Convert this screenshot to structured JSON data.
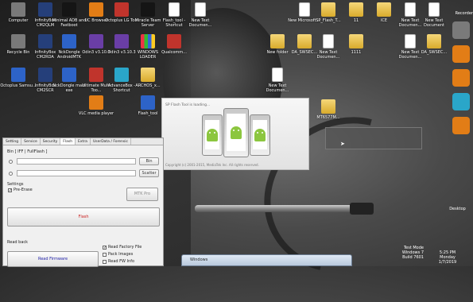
{
  "desktop": {
    "icons": [
      {
        "label": "Computer",
        "kind": "gray"
      },
      {
        "label": "InfinityBox CM2QLM",
        "kind": "navy"
      },
      {
        "label": "Minimal ADB and Fastboot",
        "kind": "black"
      },
      {
        "label": "UC Browser",
        "kind": "orange"
      },
      {
        "label": "Octoplus LG Tool",
        "kind": "red"
      },
      {
        "label": "Miracle Team Server",
        "kind": "black"
      },
      {
        "label": "Flash_tool - Shortcut",
        "kind": "doc"
      },
      {
        "label": "New Text Documen...",
        "kind": "doc"
      },
      {
        "label": "New Microsoft ...",
        "kind": "doc"
      },
      {
        "label": "SP_Flash_T...",
        "kind": "folder"
      },
      {
        "label": "11",
        "kind": "folder"
      },
      {
        "label": "ICE",
        "kind": "folder"
      },
      {
        "label": "New Text Documen...",
        "kind": "doc"
      },
      {
        "label": "New Text Document",
        "kind": "doc"
      },
      {
        "label": "Recycle Bin",
        "kind": "gray"
      },
      {
        "label": "InfinityBox CM2RDA",
        "kind": "navy"
      },
      {
        "label": "NckDongle AndroidMTK",
        "kind": "blue"
      },
      {
        "label": "Odin3 v3.10.3",
        "kind": "purple"
      },
      {
        "label": "Odin3 v3.10.3",
        "kind": "purple"
      },
      {
        "label": "WINDOWS LOADER",
        "kind": "win"
      },
      {
        "label": "Qualcomm...",
        "kind": "red"
      },
      {
        "label": "New folder",
        "kind": "folder"
      },
      {
        "label": "DA_SWSEC...",
        "kind": "folder"
      },
      {
        "label": "New Text Documen...",
        "kind": "doc"
      },
      {
        "label": "1111",
        "kind": "folder"
      },
      {
        "label": "New Text Documen...",
        "kind": "doc"
      },
      {
        "label": "DA_SWSEC...",
        "kind": "folder"
      },
      {
        "label": "Octoplus Samsu...",
        "kind": "blue"
      },
      {
        "label": "InfinityBox CM2SCR",
        "kind": "navy"
      },
      {
        "label": "NckDongle main exe",
        "kind": "blue"
      },
      {
        "label": "Ultimate Multi Too...",
        "kind": "red"
      },
      {
        "label": "AdvanceBox - Shortcut",
        "kind": "cyan"
      },
      {
        "label": "ARCHOS_x...",
        "kind": "folder"
      },
      {
        "label": "New Text Documen...",
        "kind": "doc"
      },
      {
        "label": "MT6577M...",
        "kind": "folder"
      },
      {
        "label": "VLC media player",
        "kind": "orange"
      },
      {
        "label": "Flash_tool",
        "kind": "blue"
      }
    ],
    "dock": [
      "gray",
      "orange",
      "orange",
      "cyan",
      "orange"
    ],
    "top_right_label": "Recorder",
    "desktop_label": "Desktop",
    "watermark": {
      "line1": "Test Mode",
      "line2": "Windows 7",
      "line3": "Build 7601"
    },
    "clock": {
      "time": "5:25 PM",
      "day": "Monday",
      "date": "1/7/2019"
    }
  },
  "splash": {
    "title": "SP Flash Tool is loading...",
    "copyright": "Copyright (c) 2001-2015, MediaTek Inc. All rights reserved."
  },
  "flash_tool": {
    "tabs": [
      "Setting",
      "Service",
      "Security",
      "Flash",
      "Extra",
      "UserData / Forensic"
    ],
    "active_tab": "Flash",
    "bin_group": "Bin [ IFF | FullFlash ]",
    "bin_button": "Bin",
    "scatter_button": "Scatter",
    "settings_label": "Settings",
    "pre_erase_label": "Pre-Erase",
    "pre_erase_checked": true,
    "mtk_pro_button": "MTK Pro",
    "flash_button": "Flash",
    "read_back_label": "Read back",
    "read_firmware_button": "Read Firmware",
    "read_options": [
      {
        "label": "Read Factory File",
        "checked": true
      },
      {
        "label": "Pack Images",
        "checked": false
      },
      {
        "label": "Read FW Info",
        "checked": false
      }
    ]
  },
  "taskbar": {
    "window_label": "Windows"
  }
}
